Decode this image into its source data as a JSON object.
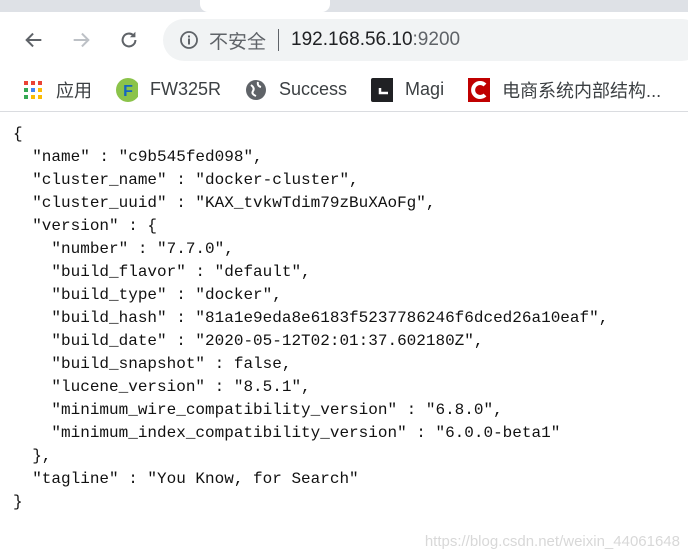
{
  "browser": {
    "address": {
      "security_label": "不安全",
      "host": "192.168.56.10",
      "port": ":9200"
    },
    "bookmarks": [
      {
        "label": "应用",
        "icon": "apps-grid-icon"
      },
      {
        "label": "FW325R",
        "icon": "fw-logo-icon",
        "color": "#8bc34a"
      },
      {
        "label": "Success",
        "icon": "globe-icon"
      },
      {
        "label": "Magi",
        "icon": "magi-icon"
      },
      {
        "label": "电商系统内部结构...",
        "icon": "csdn-icon",
        "color": "#c00000"
      }
    ]
  },
  "content": {
    "lines": [
      "{",
      "  \"name\" : \"c9b545fed098\",",
      "  \"cluster_name\" : \"docker-cluster\",",
      "  \"cluster_uuid\" : \"KAX_tvkwTdim79zBuXAoFg\",",
      "  \"version\" : {",
      "    \"number\" : \"7.7.0\",",
      "    \"build_flavor\" : \"default\",",
      "    \"build_type\" : \"docker\",",
      "    \"build_hash\" : \"81a1e9eda8e6183f5237786246f6dced26a10eaf\",",
      "    \"build_date\" : \"2020-05-12T02:01:37.602180Z\",",
      "    \"build_snapshot\" : false,",
      "    \"lucene_version\" : \"8.5.1\",",
      "    \"minimum_wire_compatibility_version\" : \"6.8.0\",",
      "    \"minimum_index_compatibility_version\" : \"6.0.0-beta1\"",
      "  },",
      "  \"tagline\" : \"You Know, for Search\"",
      "}"
    ]
  },
  "watermark": "https://blog.csdn.net/weixin_44061648"
}
